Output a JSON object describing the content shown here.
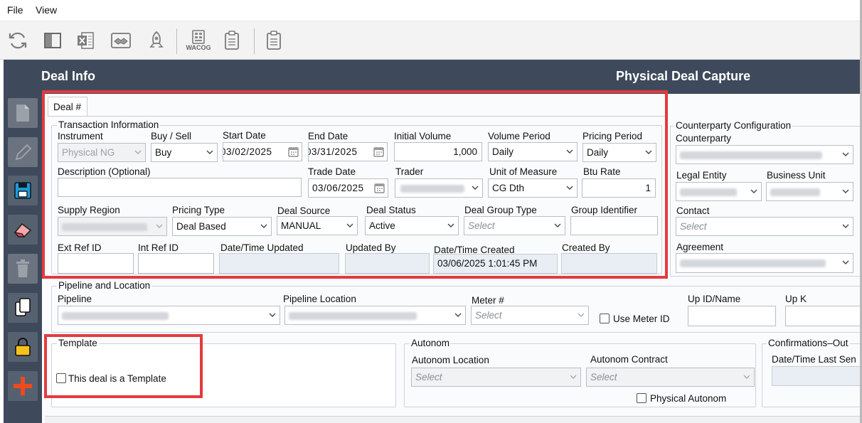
{
  "menu": {
    "file": "File",
    "view": "View"
  },
  "toolbar": {
    "wacog": "WACOG"
  },
  "header": {
    "left_title": "Deal Info",
    "right_title": "Physical Deal Capture"
  },
  "tab": {
    "label": "Deal #"
  },
  "transaction": {
    "group_label": "Transaction Information",
    "instrument": {
      "label": "Instrument",
      "value": "Physical NG"
    },
    "buy_sell": {
      "label": "Buy / Sell",
      "value": "Buy"
    },
    "start_date": {
      "label": "Start Date",
      "value": "03/02/2025"
    },
    "end_date": {
      "label": "End Date",
      "value": "03/31/2025"
    },
    "initial_volume": {
      "label": "Initial Volume",
      "value": "1,000"
    },
    "volume_period": {
      "label": "Volume Period",
      "value": "Daily"
    },
    "pricing_period": {
      "label": "Pricing Period",
      "value": "Daily"
    },
    "description": {
      "label": "Description (Optional)",
      "value": ""
    },
    "trade_date": {
      "label": "Trade Date",
      "value": "03/06/2025"
    },
    "trader": {
      "label": "Trader"
    },
    "unit_of_measure": {
      "label": "Unit of Measure",
      "value": "CG Dth"
    },
    "btu_rate": {
      "label": "Btu Rate",
      "value": "1"
    },
    "supply_region": {
      "label": "Supply Region"
    },
    "pricing_type": {
      "label": "Pricing Type",
      "value": "Deal Based"
    },
    "deal_source": {
      "label": "Deal Source",
      "value": "MANUAL"
    },
    "deal_status": {
      "label": "Deal Status",
      "value": "Active"
    },
    "deal_group_type": {
      "label": "Deal Group Type",
      "placeholder": "Select"
    },
    "group_identifier": {
      "label": "Group Identifier"
    },
    "ext_ref_id": {
      "label": "Ext Ref ID"
    },
    "int_ref_id": {
      "label": "Int Ref ID"
    },
    "datetime_updated": {
      "label": "Date/Time Updated"
    },
    "updated_by": {
      "label": "Updated By"
    },
    "datetime_created": {
      "label": "Date/Time Created",
      "value": "03/06/2025 1:01:45 PM"
    },
    "created_by": {
      "label": "Created By"
    }
  },
  "counterparty": {
    "group_label": "Counterparty Configuration",
    "counterparty_label": "Counterparty",
    "legal_entity_label": "Legal Entity",
    "business_unit_label": "Business Unit",
    "contact_label": "Contact",
    "contact_placeholder": "Select",
    "agreement_label": "Agreement"
  },
  "pipeline": {
    "group_label": "Pipeline and Location",
    "pipeline_label": "Pipeline",
    "pipeline_location_label": "Pipeline Location",
    "meter_label": "Meter #",
    "meter_placeholder": "Select",
    "use_meter_id": "Use Meter ID",
    "up_id_name": "Up ID/Name",
    "up_k": "Up K"
  },
  "template": {
    "group_label": "Template",
    "checkbox_label": "This deal is a Template"
  },
  "autonom": {
    "group_label": "Autonom",
    "location_label": "Autonom Location",
    "location_placeholder": "Select",
    "contract_label": "Autonom Contract",
    "contract_placeholder": "Select",
    "physical_label": "Physical Autonom"
  },
  "confirmations": {
    "group_label": "Confirmations–Out",
    "date_label": "Date/Time Last Sen"
  },
  "colors": {
    "header_bg": "#3e4a5b",
    "highlight": "#e23b3f",
    "sidebar_button": "#6b7380"
  }
}
